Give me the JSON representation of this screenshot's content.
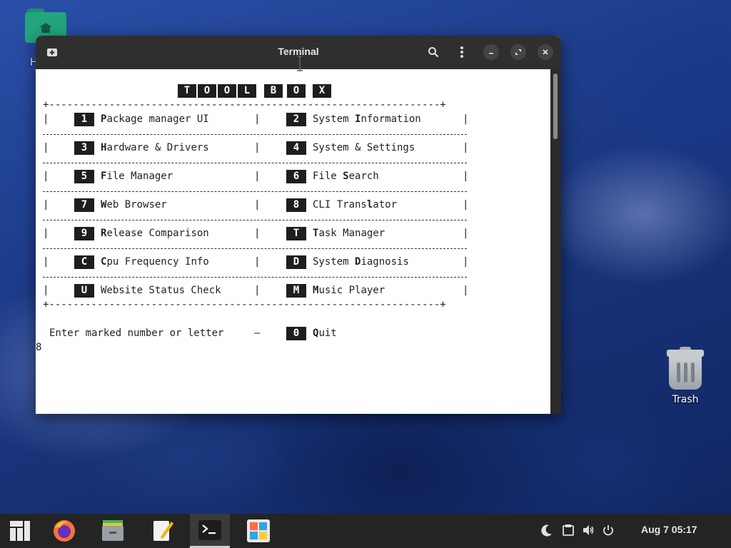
{
  "desktop": {
    "folder_label": "H",
    "trash_label": "Trash"
  },
  "window": {
    "title": "Terminal"
  },
  "terminal": {
    "title_letters": [
      "T",
      "O",
      "O",
      "L",
      "B",
      "O",
      "X"
    ],
    "border_top": "+-----------------------------------------------------------------+",
    "border_bottom": "+-----------------------------------------------------------------+",
    "rows": [
      {
        "left": {
          "key": "1",
          "hot": "P",
          "rest": "ackage manager UI",
          "pre": ""
        },
        "right": {
          "key": "2",
          "pre": "System ",
          "hot": "I",
          "rest": "nformation"
        }
      },
      {
        "left": {
          "key": "3",
          "hot": "H",
          "rest": "ardware & Drivers",
          "pre": ""
        },
        "right": {
          "key": "4",
          "pre": "System & Settings",
          "hot": "",
          "rest": ""
        }
      },
      {
        "left": {
          "key": "5",
          "hot": "F",
          "rest": "ile Manager",
          "pre": ""
        },
        "right": {
          "key": "6",
          "pre": "File ",
          "hot": "S",
          "rest": "earch"
        }
      },
      {
        "left": {
          "key": "7",
          "hot": "W",
          "rest": "eb Browser",
          "pre": ""
        },
        "right": {
          "key": "8",
          "pre": "CLI Trans",
          "hot": "l",
          "rest": "ator"
        }
      },
      {
        "left": {
          "key": "9",
          "hot": "R",
          "rest": "elease Comparison",
          "pre": ""
        },
        "right": {
          "key": "T",
          "pre": "",
          "hot": "T",
          "rest": "ask Manager"
        }
      },
      {
        "left": {
          "key": "C",
          "hot": "C",
          "rest": "pu Frequency Info",
          "pre": ""
        },
        "right": {
          "key": "D",
          "pre": "System ",
          "hot": "D",
          "rest": "iagnosis"
        }
      },
      {
        "left": {
          "key": "U",
          "hot": "",
          "rest": "Website Status Check",
          "pre": ""
        },
        "right": {
          "key": "M",
          "pre": "",
          "hot": "M",
          "rest": "usic Player"
        }
      }
    ],
    "prompt_text": "Enter marked number or letter",
    "prompt_dash": "–",
    "quit_key": "0",
    "quit_hot": "Q",
    "quit_rest": "uit",
    "input_value": "8"
  },
  "taskbar": {
    "clock": "Aug 7  05:17",
    "apps": [
      "manjaro-menu",
      "firefox",
      "file-manager",
      "text-editor",
      "terminal",
      "software-center"
    ]
  }
}
